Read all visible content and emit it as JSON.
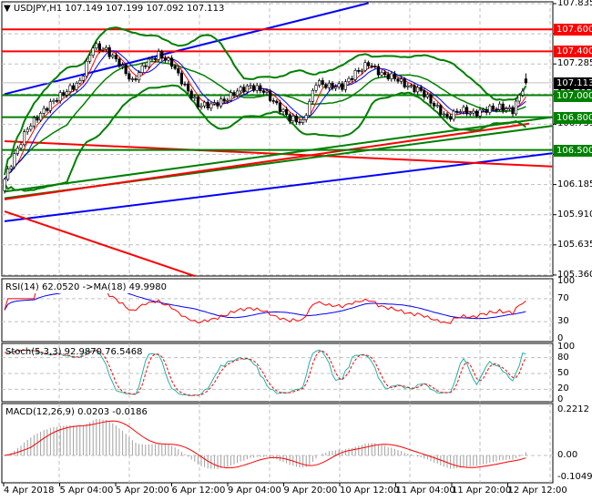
{
  "header": {
    "symbol": "USDJPY,H1",
    "open": "107.149",
    "high": "107.199",
    "low": "107.092",
    "close": "107.113"
  },
  "price_axis": [
    "107.835",
    "107.560",
    "107.285",
    "107.010",
    "106.735",
    "106.460",
    "106.185",
    "105.910",
    "105.635",
    "105.360"
  ],
  "levels": [
    {
      "label": "107.600",
      "price": 107.6,
      "color": "#ff0000"
    },
    {
      "label": "107.400",
      "price": 107.4,
      "color": "#ff0000"
    },
    {
      "label": "107.000",
      "price": 107.0,
      "color": "#008000"
    },
    {
      "label": "106.800",
      "price": 106.8,
      "color": "#008000"
    },
    {
      "label": "106.500",
      "price": 106.5,
      "color": "#008000"
    }
  ],
  "current_price": {
    "label": "107.113",
    "price": 107.113,
    "color": "#000000"
  },
  "closes": [
    106.16,
    106.45,
    106.7,
    106.83,
    106.95,
    107.04,
    107.12,
    107.45,
    107.41,
    107.29,
    107.12,
    107.29,
    107.37,
    107.29,
    107.08,
    106.91,
    106.91,
    106.95,
    107.04,
    107.08,
    107.04,
    106.91,
    106.79,
    106.75,
    107.12,
    107.08,
    107.08,
    107.2,
    107.29,
    107.19,
    107.16,
    107.08,
    107.04,
    106.91,
    106.79,
    106.87,
    106.83,
    106.87,
    106.89,
    106.86,
    107.13
  ],
  "trendlines": [
    {
      "color": "#0000ff",
      "from": [
        0,
        107.01
      ],
      "to": [
        111,
        107.84
      ]
    },
    {
      "color": "#0000ff",
      "from": [
        0,
        105.85
      ],
      "to": [
        167,
        106.47
      ]
    },
    {
      "color": "#ff0000",
      "from": [
        0,
        105.94
      ],
      "to": [
        58,
        105.35
      ]
    },
    {
      "color": "#ff0000",
      "from": [
        0,
        106.58
      ],
      "to": [
        167,
        106.35
      ]
    },
    {
      "color": "#008000",
      "from": [
        0,
        106.12
      ],
      "to": [
        167,
        106.8
      ]
    },
    {
      "color": "#008000",
      "from": [
        0,
        106.06
      ],
      "to": [
        167,
        106.72
      ]
    },
    {
      "color": "#ff0000",
      "from": [
        0,
        106.05
      ],
      "to": [
        160,
        106.74
      ]
    }
  ],
  "rsi": {
    "label": "RSI(14) 62.0520  ->MA(18) 49.9980",
    "axis": [
      "100",
      "70",
      "30",
      "0"
    ]
  },
  "stoch": {
    "label": "Stoch(5,3,3) 92.9870 76.5468",
    "axis": [
      "100",
      "80",
      "50",
      "20",
      "0"
    ]
  },
  "macd": {
    "label": "MACD(12,26,9) 0.0203 -0.0186",
    "axis": [
      "0.2212",
      "0.00",
      "-0.1049"
    ]
  },
  "time_axis": [
    "4 Apr 2018",
    "5 Apr 04:00",
    "5 Apr 20:00",
    "6 Apr 12:00",
    "9 Apr 04:00",
    "9 Apr 20:00",
    "10 Apr 12:00",
    "11 Apr 04:00",
    "11 Apr 20:00",
    "12 Apr 12:00"
  ]
}
